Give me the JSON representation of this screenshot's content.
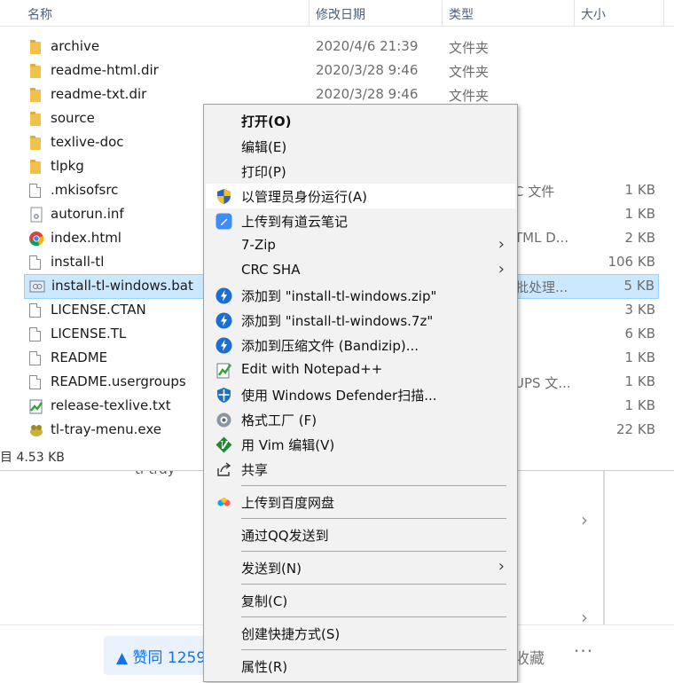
{
  "columns": {
    "name": "名称",
    "modified": "修改日期",
    "type": "类型",
    "size": "大小"
  },
  "files": [
    {
      "name": "archive",
      "date": "2020/4/6 21:39",
      "type": "文件夹",
      "size": ""
    },
    {
      "name": "readme-html.dir",
      "date": "2020/3/28 9:46",
      "type": "文件夹",
      "size": ""
    },
    {
      "name": "readme-txt.dir",
      "date": "2020/3/28 9:46",
      "type": "文件夹",
      "size": ""
    },
    {
      "name": "source",
      "date": "",
      "type": "",
      "size": ""
    },
    {
      "name": "texlive-doc",
      "date": "",
      "type": "",
      "size": ""
    },
    {
      "name": "tlpkg",
      "date": "",
      "type": "",
      "size": ""
    },
    {
      "name": ".mkisofsrc",
      "date": "",
      "type": "C 文件",
      "size": "1 KB"
    },
    {
      "name": "autorun.inf",
      "date": "",
      "type": "",
      "size": "1 KB"
    },
    {
      "name": "index.html",
      "date": "",
      "type": "TML D...",
      "size": "2 KB"
    },
    {
      "name": "install-tl",
      "date": "",
      "type": "",
      "size": "106 KB"
    },
    {
      "name": "install-tl-windows.bat",
      "date": "",
      "type": "批处理...",
      "size": "5 KB"
    },
    {
      "name": "LICENSE.CTAN",
      "date": "",
      "type": "",
      "size": "3 KB"
    },
    {
      "name": "LICENSE.TL",
      "date": "",
      "type": "",
      "size": "6 KB"
    },
    {
      "name": "README",
      "date": "",
      "type": "",
      "size": "1 KB"
    },
    {
      "name": "README.usergroups",
      "date": "",
      "type": "UPS 文...",
      "size": "1 KB"
    },
    {
      "name": "release-texlive.txt",
      "date": "",
      "type": "",
      "size": "1 KB"
    },
    {
      "name": "tl-tray-menu.exe",
      "date": "",
      "type": "",
      "size": "22 KB"
    }
  ],
  "status": {
    "selected_size": "目 4.53 KB"
  },
  "context_menu": {
    "items": [
      {
        "label": "打开(O)",
        "icon": ""
      },
      {
        "label": "编辑(E)",
        "icon": ""
      },
      {
        "label": "打印(P)",
        "icon": ""
      },
      {
        "label": "以管理员身份运行(A)",
        "icon": "uac-shield-icon"
      },
      {
        "label": "上传到有道云笔记",
        "icon": "youdao-note-icon"
      },
      {
        "label": "7-Zip",
        "icon": ""
      },
      {
        "label": "CRC SHA",
        "icon": ""
      },
      {
        "label": "添加到 \"install-tl-windows.zip\"",
        "icon": "bandizip-icon"
      },
      {
        "label": "添加到 \"install-tl-windows.7z\"",
        "icon": "bandizip-icon"
      },
      {
        "label": "添加到压缩文件 (Bandizip)...",
        "icon": "bandizip-icon"
      },
      {
        "label": "Edit with Notepad++",
        "icon": "notepad-plus-plus-icon"
      },
      {
        "label": "使用 Windows Defender扫描...",
        "icon": "windows-defender-icon"
      },
      {
        "label": "格式工厂 (F)",
        "icon": "format-factory-icon"
      },
      {
        "label": "用 Vim 编辑(V)",
        "icon": "vim-icon"
      },
      {
        "label": "共享",
        "icon": "share-icon"
      },
      {
        "label": "上传到百度网盘",
        "icon": "baidu-netdisk-icon"
      },
      {
        "label": "通过QQ发送到",
        "icon": ""
      },
      {
        "label": "发送到(N)",
        "icon": ""
      },
      {
        "label": "复制(C)",
        "icon": ""
      },
      {
        "label": "创建快捷方式(S)",
        "icon": ""
      },
      {
        "label": "属性(R)",
        "icon": ""
      }
    ]
  },
  "background_page": {
    "tray_text": "tl-tray",
    "vote_label": "▲ 赞同 1259",
    "favorite_label": "收藏",
    "more_label": "···"
  },
  "colors": {
    "selection": "#cce8ff",
    "menu_bg": "#f2f2f2",
    "vote_blue": "#1772e6"
  }
}
